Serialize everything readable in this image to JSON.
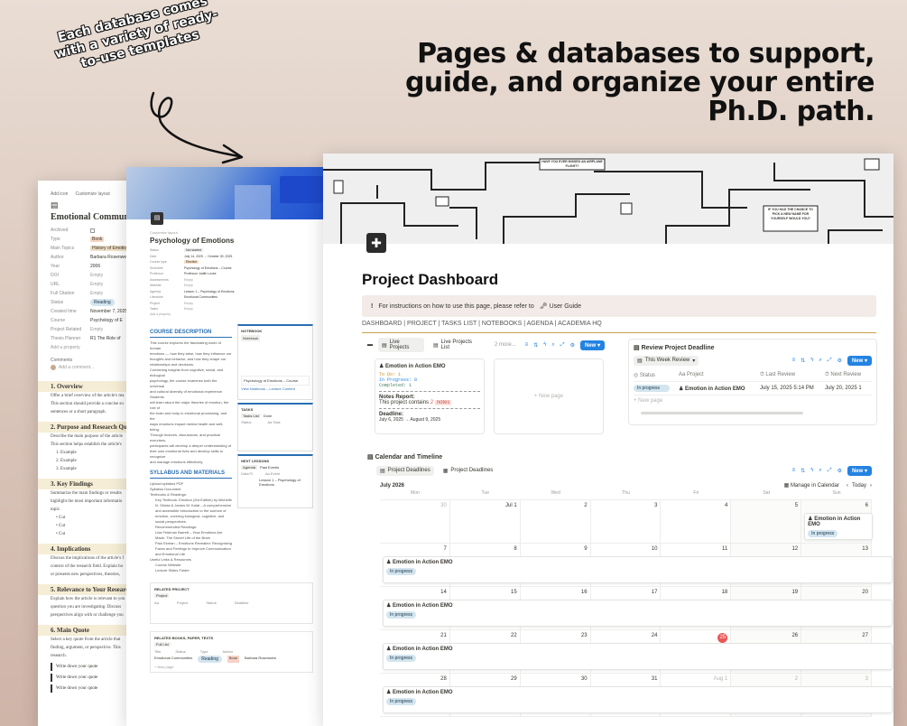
{
  "headline": {
    "line1": "Pages & databases to support,",
    "line2": "guide, and organize your entire",
    "line3": "Ph.D. path."
  },
  "annotation": {
    "line1": "Each database comes",
    "line2": "with a variety of ready-",
    "line3": "to-use templates"
  },
  "page1": {
    "top_links": [
      "Add icon",
      "Customize layout"
    ],
    "title": "Emotional Commun",
    "props": [
      {
        "k": "Archived",
        "v": ""
      },
      {
        "k": "Type",
        "v": "Book"
      },
      {
        "k": "Main Topics",
        "v": "History of Emotion"
      },
      {
        "k": "Author",
        "v": "Barbara Rosenwein"
      },
      {
        "k": "Year",
        "v": "2006"
      },
      {
        "k": "DOI",
        "v": "Empty"
      },
      {
        "k": "URL",
        "v": "Empty"
      },
      {
        "k": "Full Citation",
        "v": "Empty"
      },
      {
        "k": "Status",
        "v": "Reading"
      },
      {
        "k": "Created time",
        "v": "November 7, 2025"
      },
      {
        "k": "Course",
        "v": "Psychology of E"
      },
      {
        "k": "Project Related",
        "v": "Empty"
      },
      {
        "k": "Thesis Planner",
        "v": "R1 The Role of"
      }
    ],
    "add_property": "Add a property",
    "comments": "Comments",
    "add_comment": "Add a comment...",
    "sections": [
      {
        "h": "1. Overview",
        "p": [
          "Offer a brief overview of the article's ma",
          "This section should provide a concise su",
          "sentences or a short paragraph."
        ]
      },
      {
        "h": "2. Purpose and Research Quest",
        "p": [
          "Describe the main purpose of the article",
          "This section helps establish the article's"
        ]
      },
      {
        "h": "3. Key Findings",
        "p": [
          "Summarize the main findings or results",
          "highlight the most important informatio",
          "topic."
        ]
      },
      {
        "h": "4. Implications",
        "p": [
          "Discuss the implications of the article's f",
          "context of the research field. Explain ho",
          "or presents new perspectives, theories,"
        ]
      },
      {
        "h": "5. Relevance to Your Research",
        "p": [
          "Explain how the article is relevant to you",
          "question you are investigating. Discuss",
          "perspectives align with or challenge you"
        ]
      },
      {
        "h": "6. Main Quote",
        "p": [
          "Select a key quote from the article that",
          "finding, argument, or perspective. This",
          "research."
        ]
      }
    ],
    "examples": [
      "Example",
      "Example",
      "Example"
    ],
    "cuts": [
      "Cut",
      "Cut",
      "Cut"
    ],
    "quotes": [
      "Write down your quote",
      "Write down your quote",
      "Write down your quote"
    ]
  },
  "page2": {
    "add_cover": "Customize layout",
    "title": "Psychology of Emotions",
    "props": [
      {
        "k": "Status",
        "v": "Not started"
      },
      {
        "k": "Date",
        "v": "July 14, 2025 → October 30, 2025"
      },
      {
        "k": "Course type",
        "v": "Elective"
      },
      {
        "k": "Schedule",
        "v": "Psychology of Emotions – Course"
      },
      {
        "k": "Professor",
        "v": "Professor Judith Locke"
      },
      {
        "k": "Assessments",
        "v": "Empty"
      },
      {
        "k": "Website",
        "v": "Empty"
      },
      {
        "k": "Agenda",
        "v": "Lesson 1 – Psychology of Emotions"
      },
      {
        "k": "Literature",
        "v": "Emotional Communities"
      },
      {
        "k": "Project",
        "v": "Empty"
      },
      {
        "k": "Tasks",
        "v": "Empty"
      }
    ],
    "add_property": "Add a property",
    "course_description_h": "COURSE DESCRIPTION",
    "course_description": [
      "This course explores the fascinating world of human",
      "emotions — how they arise, how they influence our",
      "thoughts and behavior, and how they shape our",
      "relationships and decisions.",
      "Combining insights from cognitive, social, and biological",
      "psychology, the course examines both the universal",
      "and cultural diversity of emotional experience. Students",
      "will learn about the major theories of emotion, the role of",
      "the brain and body in emotional processing, and the",
      "ways emotions impact mental health and well-being.",
      "Through lectures, discussions, and practical exercises,",
      "participants will develop a deeper understanding of",
      "their own emotional lives and develop skills to recognize",
      "and manage emotions effectively."
    ],
    "syllabus_h": "SYLLABUS AND MATERIALS",
    "syllabus": [
      "Upload syllabus PDF",
      "Syllabus Document",
      "Textbooks & Readings:",
      "Key Textbook: Emotion (3rd Edition) by Michelle N. Shiota & James W. Kalat – A comprehensive and accessible introduction to the science of emotion, covering biological, cognitive, and social perspectives.",
      "Recommended Readings:",
      "Lisa Feldman Barrett – How Emotions Are Made: The Secret Life of the Brain",
      "Paul Ekman – Emotions Revealed: Recognizing Faces and Feelings to Improve Communication and Emotional Life",
      "Useful Links & Resources",
      "Course Website",
      "Lecture Slides Folder"
    ],
    "notebook_h": "NOTEBOOK",
    "notebook_tab": "Notebook",
    "notebook_item": "Psychology of Emotions – Course",
    "notebook_link": "View Notebook – Lecture Content",
    "tasks_h": "TASKS",
    "tasks_tab": "Tasks List",
    "tasks_tab2": "Done",
    "tasks_cols": [
      "Status",
      "Aa Task"
    ],
    "next_lessons_h": "NEXT LESSONS",
    "next_tabs": [
      "Agenda",
      "Past Events"
    ],
    "next_cols": [
      "Date/Ti",
      "Aa Event"
    ],
    "next_item": "Lesson 1 – Psychology of Emotions",
    "related_project_h": "RELATED PROJECT",
    "project_tab": "Project",
    "project_cols": [
      "Aa",
      "Project",
      "Status",
      "Deadline"
    ],
    "related_books_h": "RELATED BOOKS, PAPER, TEXTS",
    "books_tab": "Full List",
    "books_cols": [
      "Title",
      "Status",
      "Type",
      "Author"
    ],
    "books_row": [
      "Emotional Communities",
      "Reading",
      "Book",
      "Barbara Rosenwein"
    ],
    "new_page": "+ New page"
  },
  "dashboard": {
    "cover_signs": [
      "HAVE YOU EVER MISSED AN AIRPLANE FLIGHT?",
      "IF YOU HAD THE CHANCE TO PICK A NEW NAME FOR YOURSELF WOULD YOU?"
    ],
    "title": "Project Dashboard",
    "callout": "For instructions on how to use this page, please refer to",
    "callout_link": "User Guide",
    "nav": "DASHBOARD | PROJECT | TASKS LIST | NOTEBOOKS | AGENDA | ACADEMIA HQ",
    "projects": {
      "tabs": [
        "Live Projects",
        "Live Projects List",
        "2 more..."
      ],
      "new_label": "New",
      "card_title": "Emotion in Action EMO",
      "card_lines": [
        "To Do: 1",
        "In Progress: 0",
        "Completed: 1"
      ],
      "notes_label": "Notes Report:",
      "notes_text": "This project contains",
      "notes_count": "2",
      "notes_unit": "notes",
      "deadline_label": "Deadline:",
      "deadline_value": "July 6, 2025 → August 9, 2025",
      "new_page": "+ New page"
    },
    "review": {
      "title": "Review Project Deadline",
      "view": "This Week Review",
      "new_label": "New",
      "cols": [
        "Status",
        "Aa Project",
        "Last Review",
        "Next Review"
      ],
      "row": [
        "In progress",
        "Emotion in Action EMO",
        "July 15, 2025 5:14 PM",
        "July 20, 2025 1"
      ],
      "new_page": "+ New page"
    },
    "calendar": {
      "title": "Calendar and Timeline",
      "tabs": [
        "Project Deadlines",
        "Project Deadlines"
      ],
      "new_label": "New",
      "month": "July 2026",
      "manage": "Manage in Calendar",
      "today": "Today",
      "days": [
        "Mon",
        "Tue",
        "Wed",
        "Thu",
        "Fri",
        "Sat",
        "Sun"
      ],
      "weeks": [
        [
          "30",
          "Jul 1",
          "2",
          "3",
          "4",
          "5",
          "6"
        ],
        [
          "7",
          "8",
          "9",
          "10",
          "11",
          "12",
          "13"
        ],
        [
          "14",
          "15",
          "16",
          "17",
          "18",
          "19",
          "20"
        ],
        [
          "21",
          "22",
          "23",
          "24",
          "25",
          "26",
          "27"
        ],
        [
          "28",
          "29",
          "30",
          "31",
          "Aug 1",
          "2",
          "3"
        ]
      ],
      "event_name": "Emotion in Action EMO",
      "event_status": "In progress",
      "today_num": "25"
    }
  },
  "colors": {
    "accent": "#2383e2",
    "divider": "#c9a24a",
    "today": "#eb5757"
  }
}
